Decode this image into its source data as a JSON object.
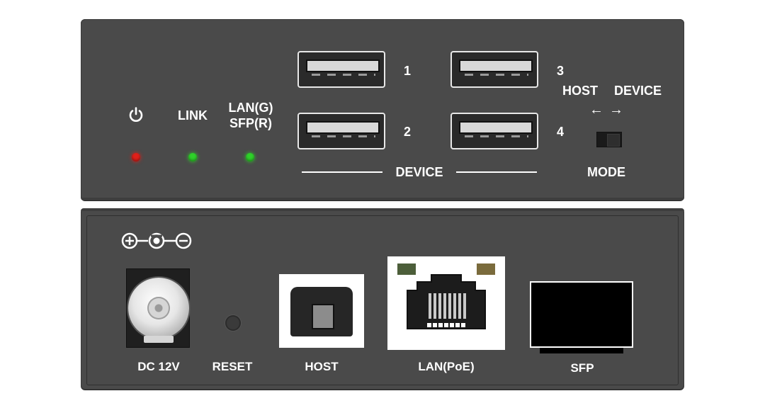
{
  "front_panel": {
    "power_led": {
      "color": "#e0201a"
    },
    "link": {
      "label": "LINK",
      "led_color": "#2fd12a"
    },
    "lan": {
      "label_line1": "LAN(G)",
      "label_line2": "SFP(R)",
      "led_color": "#2fd12a"
    },
    "usb_ports": [
      {
        "number": "1"
      },
      {
        "number": "2"
      },
      {
        "number": "3"
      },
      {
        "number": "4"
      }
    ],
    "device_label": "DEVICE",
    "mode": {
      "host_label": "HOST",
      "device_label": "DEVICE",
      "arrow_left": "←",
      "arrow_right": "→",
      "label": "MODE"
    }
  },
  "rear_panel": {
    "dc": {
      "label": "DC 12V"
    },
    "reset": {
      "label": "RESET"
    },
    "host": {
      "label": "HOST"
    },
    "lan": {
      "label": "LAN(PoE)"
    },
    "sfp": {
      "label": "SFP"
    }
  },
  "icons": [
    "power-icon",
    "dc-polarity-icon",
    "usb-a-port-icon",
    "usb-b-port-icon",
    "rj45-port-icon",
    "sfp-cage-icon"
  ],
  "colors": {
    "panel": "#4a4a4a",
    "text": "#ffffff",
    "led_red": "#e0201a",
    "led_green": "#2fd12a"
  }
}
